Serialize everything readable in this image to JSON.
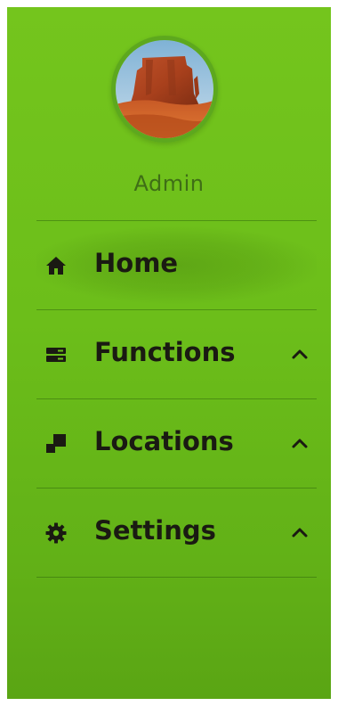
{
  "profile": {
    "username": "Admin"
  },
  "menu": {
    "items": [
      {
        "label": "Home",
        "icon": "home-icon",
        "expandable": false,
        "active": true
      },
      {
        "label": "Functions",
        "icon": "server-icon",
        "expandable": true,
        "active": false
      },
      {
        "label": "Locations",
        "icon": "clone-icon",
        "expandable": true,
        "active": false
      },
      {
        "label": "Settings",
        "icon": "gear-icon",
        "expandable": true,
        "active": false
      }
    ]
  },
  "colors": {
    "sidebar_background": "#6cbe1a",
    "avatar_border": "#5da81e",
    "username_text": "#3f6e16",
    "menu_text": "#1a1a12"
  }
}
